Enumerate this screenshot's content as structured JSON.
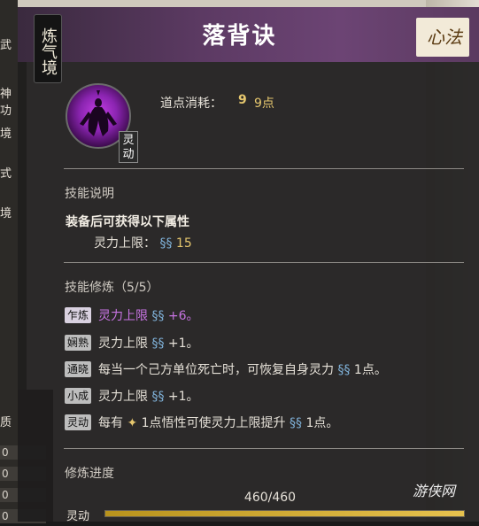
{
  "window": {
    "title": "落背诀",
    "realm": "炼气境",
    "category_badge": "心法"
  },
  "background_left": {
    "tabs": [
      "武",
      "神功",
      "境",
      "式",
      "境",
      "质"
    ],
    "values": [
      "0",
      "0",
      "0",
      "0"
    ],
    "bottom_label": "灵动"
  },
  "skill": {
    "icon_name": "meditating-figure-icon",
    "tag": "灵动",
    "cost_label": "道点消耗：",
    "cost_value": "9点"
  },
  "description": {
    "title": "技能说明",
    "line1": "装备后可获得以下属性",
    "stat_label": "灵力上限：",
    "stat_value": "15"
  },
  "cultivation": {
    "title": "技能修炼（5/5）",
    "rows": [
      {
        "tag": "乍炼",
        "text": "灵力上限",
        "value": "+6。",
        "active": true
      },
      {
        "tag": "娴熟",
        "text": "灵力上限",
        "value": "+1。",
        "active": false
      },
      {
        "tag": "通晓",
        "text": "每当一个己方单位死亡时，可恢复自身灵力",
        "value": "1点。",
        "active": false
      },
      {
        "tag": "小成",
        "text": "灵力上限",
        "value": "+1。",
        "active": false
      },
      {
        "tag": "灵动",
        "text_pre": "每有",
        "text_mid": "1点悟性可使灵力上限提升",
        "value": "1点。",
        "active": false
      }
    ]
  },
  "progress": {
    "label": "修炼进度",
    "text": "460/460",
    "fraction": 1.0
  },
  "watermark": "游侠网",
  "colors": {
    "header": "#5c3a63",
    "accent_gold": "#e6c76e",
    "accent_purple": "#c774e2",
    "accent_blue": "#7fb1d8"
  }
}
